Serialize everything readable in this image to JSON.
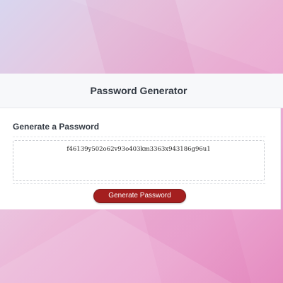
{
  "header": {
    "title": "Password Generator"
  },
  "card": {
    "title": "Generate a Password",
    "password_value": "f46139y502o62v93o403km3363x943186g96u1",
    "button_label": "Generate Password"
  },
  "colors": {
    "accent": "#a41f1f",
    "background_gradient_start": "#d8d6ef",
    "background_gradient_end": "#e27fb9"
  }
}
